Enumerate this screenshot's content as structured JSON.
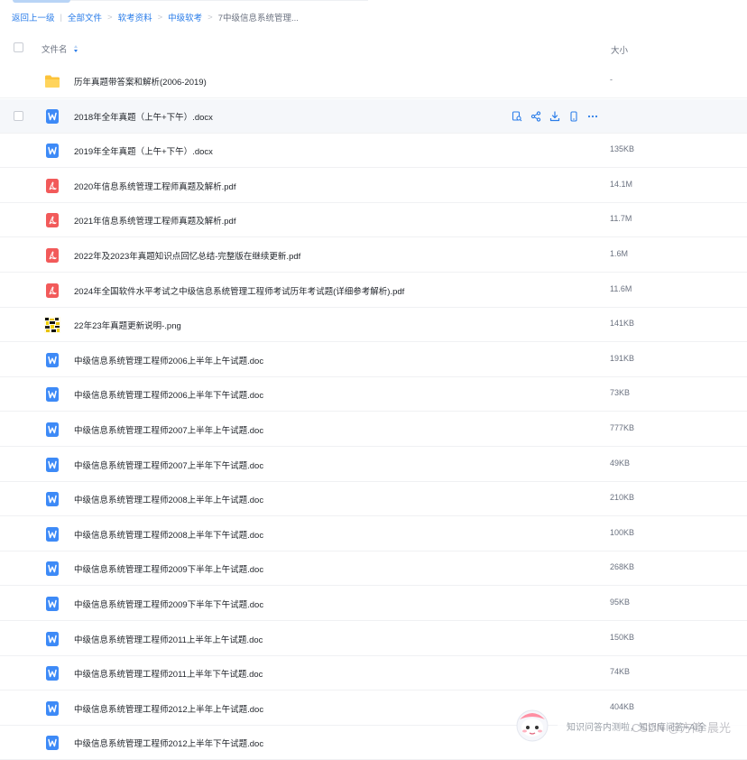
{
  "breadcrumb": {
    "back": "返回上一级",
    "separator": "|",
    "items": [
      "全部文件",
      "软考资料",
      "中级软考"
    ],
    "arrow": ">",
    "current": "7中级信息系统管理..."
  },
  "table": {
    "name_header": "文件名",
    "size_header": "大小"
  },
  "files": [
    {
      "name": "历年真题带答案和解析(2006-2019)",
      "size": "-",
      "type": "folder"
    },
    {
      "name": "2018年全年真题（上午+下午）.docx",
      "size": "",
      "type": "word",
      "hover": true
    },
    {
      "name": "2019年全年真题（上午+下午）.docx",
      "size": "135KB",
      "type": "word"
    },
    {
      "name": "2020年信息系统管理工程师真题及解析.pdf",
      "size": "14.1M",
      "type": "pdf"
    },
    {
      "name": "2021年信息系统管理工程师真题及解析.pdf",
      "size": "11.7M",
      "type": "pdf"
    },
    {
      "name": "2022年及2023年真题知识点回忆总结-完整版在继续更新.pdf",
      "size": "1.6M",
      "type": "pdf"
    },
    {
      "name": "2024年全国软件水平考试之中级信息系统管理工程师考试历年考试题(详细参考解析).pdf",
      "size": "11.6M",
      "type": "pdf"
    },
    {
      "name": "22年23年真题更新说明-.png",
      "size": "141KB",
      "type": "image"
    },
    {
      "name": "中级信息系统管理工程师2006上半年上午试题.doc",
      "size": "191KB",
      "type": "word"
    },
    {
      "name": "中级信息系统管理工程师2006上半年下午试题.doc",
      "size": "73KB",
      "type": "word"
    },
    {
      "name": "中级信息系统管理工程师2007上半年上午试题.doc",
      "size": "777KB",
      "type": "word"
    },
    {
      "name": "中级信息系统管理工程师2007上半年下午试题.doc",
      "size": "49KB",
      "type": "word"
    },
    {
      "name": "中级信息系统管理工程师2008上半年上午试题.doc",
      "size": "210KB",
      "type": "word"
    },
    {
      "name": "中级信息系统管理工程师2008上半年下午试题.doc",
      "size": "100KB",
      "type": "word"
    },
    {
      "name": "中级信息系统管理工程师2009下半年上午试题.doc",
      "size": "268KB",
      "type": "word"
    },
    {
      "name": "中级信息系统管理工程师2009下半年下午试题.doc",
      "size": "95KB",
      "type": "word"
    },
    {
      "name": "中级信息系统管理工程师2011上半年上午试题.doc",
      "size": "150KB",
      "type": "word"
    },
    {
      "name": "中级信息系统管理工程师2011上半年下午试题.doc",
      "size": "74KB",
      "type": "word"
    },
    {
      "name": "中级信息系统管理工程师2012上半年上午试题.doc",
      "size": "404KB",
      "type": "word"
    },
    {
      "name": "中级信息系统管理工程师2012上半年下午试题.doc",
      "size": "",
      "type": "word"
    }
  ],
  "row_actions": [
    "open-icon",
    "share-icon",
    "download-icon",
    "mobile-icon",
    "more-icon"
  ],
  "ai_assistant": {
    "text": "知识问答内测啦，知识库问答+AI全"
  },
  "watermark": "CSDN @方简·晨光",
  "colors": {
    "accent": "#2b7de9",
    "word": "#3d8af7",
    "pdf": "#f25a5a",
    "folder": "#fcc33a"
  }
}
